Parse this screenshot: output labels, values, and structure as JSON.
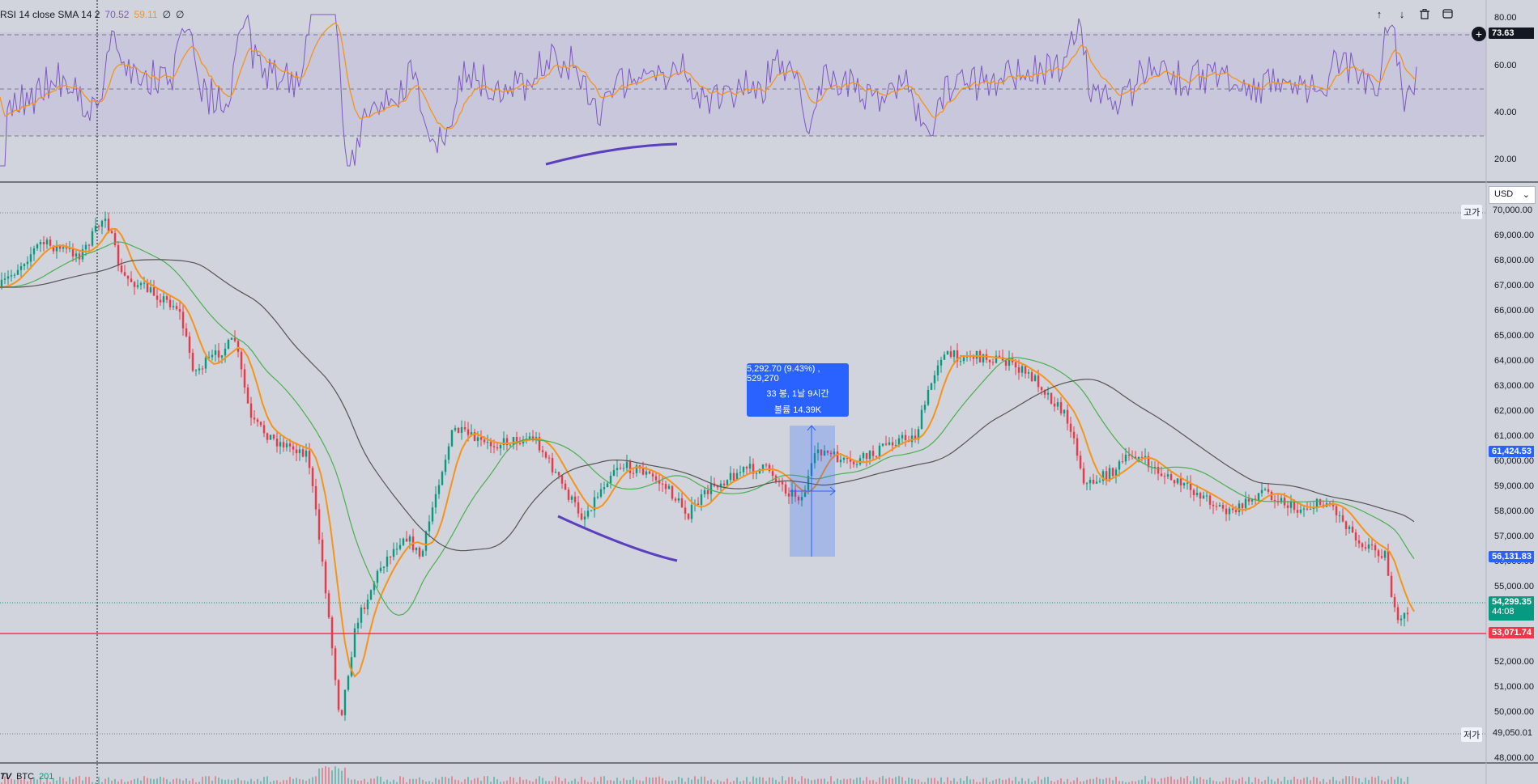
{
  "rsi_panel": {
    "legend": {
      "name": "RSI 14 close SMA 14 2",
      "rsi_value": "70.52",
      "sma_value": "59.11",
      "extra1": "∅",
      "extra2": "∅"
    },
    "axis_labels": [
      "80.00",
      "60.00",
      "40.00",
      "20.00"
    ],
    "crosshair_value": "73.63",
    "toolbar": {
      "up_icon": "arrow-up-icon",
      "down_icon": "arrow-down-icon",
      "delete_icon": "trash-icon",
      "maximize_icon": "maximize-icon"
    }
  },
  "price_panel": {
    "currency": "USD",
    "high_label": "고가",
    "high_value": "70,000.00",
    "low_label": "저가",
    "low_value": "49,050.01",
    "axis_labels": [
      "69,000.00",
      "68,000.00",
      "67,000.00",
      "66,000.00",
      "65,000.00",
      "64,000.00",
      "63,000.00",
      "62,000.00",
      "61,000.00",
      "60,000.00",
      "59,000.00",
      "58,000.00",
      "57,000.00",
      "56,000.00",
      "55,000.00",
      "52,000.00",
      "51,000.00",
      "50,000.00",
      "48,000.00"
    ],
    "tag_blue_1": "61,424.53",
    "tag_blue_2": "56,131.83",
    "tag_last_price": "54,299.35",
    "tag_countdown": "44:08",
    "tag_red_line": "53,071.74"
  },
  "measure_tool": {
    "line1": "5,292.70 (9.43%) , 529,270",
    "line2": "33 봉, 1날 9시간",
    "line3": "볼륨 14.39K"
  },
  "volume_panel": {
    "logo": "TV",
    "symbol": "BTC",
    "value": "201"
  },
  "colors": {
    "background": "#d1d4dc",
    "rsi_line": "#7e57c2",
    "rsi_sma": "#f7931a",
    "up_candle": "#089981",
    "down_candle": "#f23645",
    "ma_fast": "#f7931a",
    "ma_mid": "#4caf50",
    "ma_slow": "#555555",
    "support_line": "#f23645",
    "measure": "#2962ff",
    "divergence": "#5b3fbf"
  }
}
